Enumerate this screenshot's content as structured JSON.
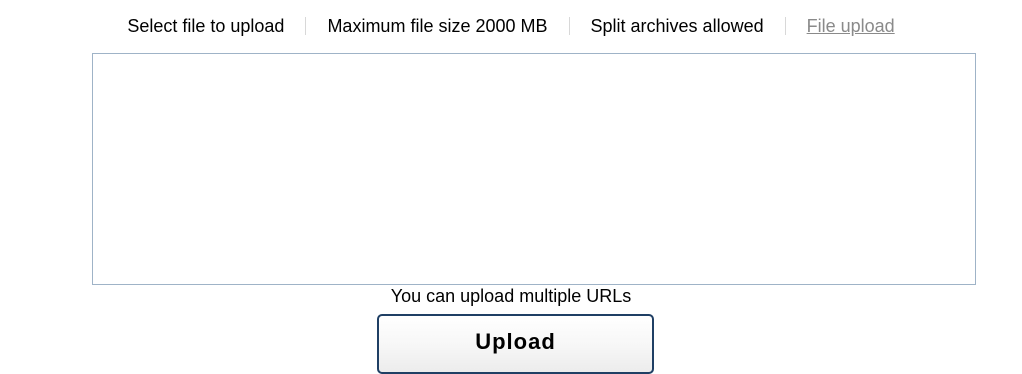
{
  "info_bar": {
    "select_file": "Select file to upload",
    "max_size": "Maximum file size 2000 MB",
    "split_archives": "Split archives allowed",
    "file_upload_link": "File upload"
  },
  "url_input": {
    "value": "",
    "placeholder": ""
  },
  "hint": "You can upload multiple URLs",
  "upload_button": "Upload"
}
